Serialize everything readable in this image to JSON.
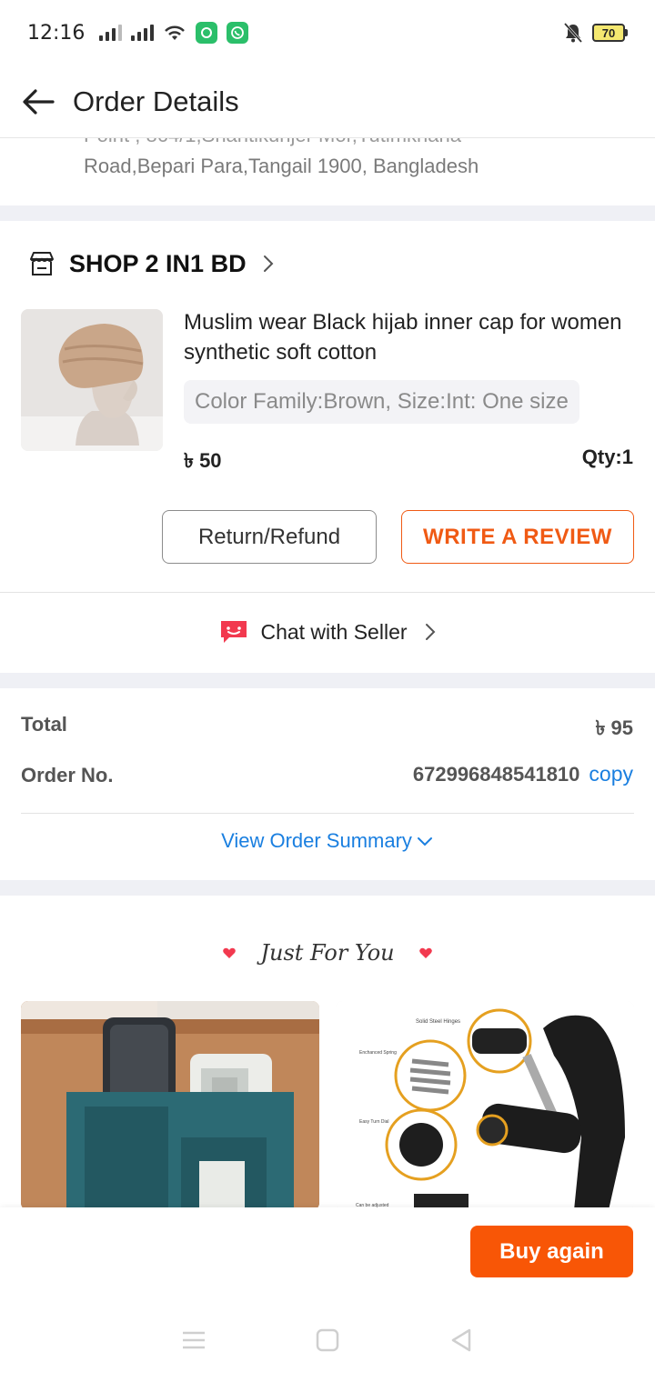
{
  "status_bar": {
    "time": "12:16",
    "battery": "70",
    "icons": [
      "signal-icon",
      "signal-icon",
      "wifi-icon",
      "app-icon",
      "whatsapp-icon",
      "mute-icon",
      "battery-icon"
    ]
  },
  "header": {
    "title": "Order Details",
    "back_icon": "back-arrow-icon"
  },
  "address": {
    "partial_line": "Point , 864/1,Shantikunjer Mor,Tutimkhana",
    "line": "Road,Bepari Para,Tangail 1900, Bangladesh"
  },
  "shop": {
    "name": "SHOP 2 IN1 BD",
    "icon": "store-icon"
  },
  "product": {
    "title": "Muslim wear Black hijab inner cap for women synthetic soft cotton",
    "variant": "Color Family:Brown, Size:Int: One size",
    "price": "৳ 50",
    "qty": "Qty:1"
  },
  "actions": {
    "return_label": "Return/Refund",
    "review_label": "WRITE A REVIEW",
    "chat_label": "Chat with Seller"
  },
  "totals": {
    "total_label": "Total",
    "total_value": "৳ 95",
    "order_label": "Order No.",
    "order_value": "672996848541810",
    "copy_label": "copy",
    "summary_label": "View Order Summary"
  },
  "recommend": {
    "title": "Just For You"
  },
  "bottom": {
    "buy_again_label": "Buy again"
  },
  "colors": {
    "accent": "#f85606",
    "link": "#1a7fe0",
    "review_border": "#f05a14",
    "band": "#eff0f5"
  }
}
